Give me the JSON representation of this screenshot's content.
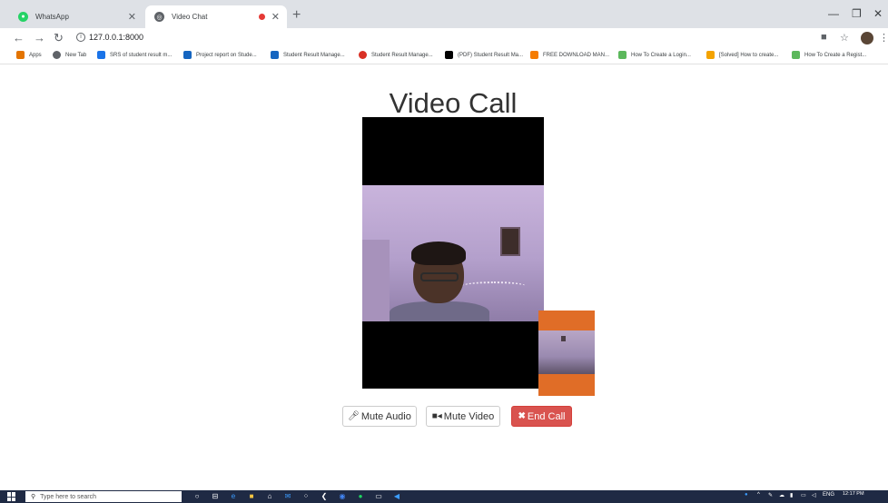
{
  "browser": {
    "tabs": [
      {
        "title": "WhatsApp",
        "favicon": "whatsapp-icon",
        "favicon_color": "#25d366",
        "active": false
      },
      {
        "title": "Video Chat",
        "favicon": "globe-icon",
        "favicon_color": "#5f6368",
        "active": true
      }
    ],
    "address": "127.0.0.1:8000",
    "bookmarks": [
      {
        "label": "Apps",
        "icon": "apps-grid-icon",
        "color": "#e37400"
      },
      {
        "label": "New Tab",
        "icon": "globe-icon",
        "color": "#5f6368"
      },
      {
        "label": "SRS of student result m...",
        "icon": "graduation-icon",
        "color": "#1a73e8"
      },
      {
        "label": "Project report on Stude...",
        "icon": "p-icon",
        "color": "#1565c0"
      },
      {
        "label": "Student Result Manage...",
        "icon": "p-icon",
        "color": "#1565c0"
      },
      {
        "label": "Student Result Manage...",
        "icon": "gear-icon",
        "color": "#d93025"
      },
      {
        "label": "(PDF) Student Result Ma...",
        "icon": "a-icon",
        "color": "#000000"
      },
      {
        "label": "FREE DOWNLOAD MAN...",
        "icon": "square-icon",
        "color": "#f57c00"
      },
      {
        "label": "How To Create a Login...",
        "icon": "square-icon",
        "color": "#5cb85c"
      },
      {
        "label": "[Solved] How to create...",
        "icon": "square-icon",
        "color": "#f4a300"
      },
      {
        "label": "How To Create a Regist...",
        "icon": "square-icon",
        "color": "#5cb85c"
      }
    ]
  },
  "page": {
    "title": "Video Call",
    "buttons": {
      "mute_audio": "Mute Audio",
      "mute_video": "Mute Video",
      "end_call": "End Call"
    }
  },
  "taskbar": {
    "search_placeholder": "Type here to search",
    "language": "ENG",
    "time": "12:17 PM"
  },
  "colors": {
    "end_call": "#d9534f",
    "local_video_bg": "#e06d27",
    "taskbar": "#1f2a44"
  }
}
